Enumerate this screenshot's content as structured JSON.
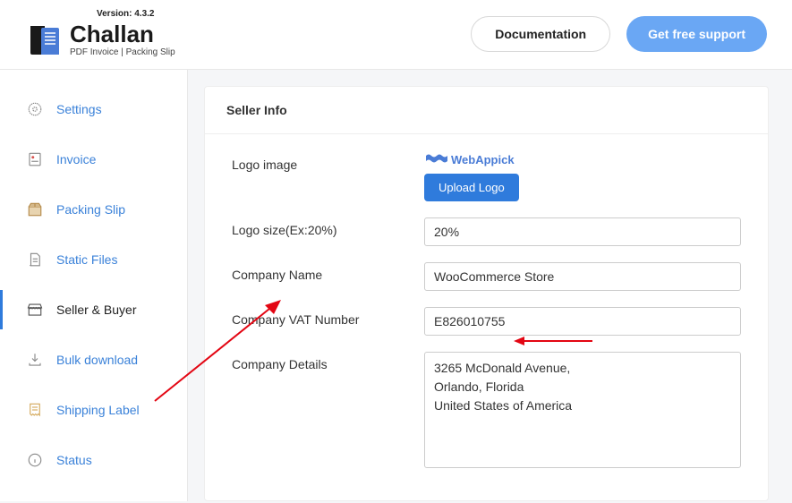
{
  "header": {
    "version_label": "Version: 4.3.2",
    "brand_name": "Challan",
    "brand_sub": "PDF Invoice | Packing Slip",
    "documentation_label": "Documentation",
    "support_label": "Get free support"
  },
  "sidebar": {
    "items": [
      {
        "label": "Settings"
      },
      {
        "label": "Invoice"
      },
      {
        "label": "Packing Slip"
      },
      {
        "label": "Static Files"
      },
      {
        "label": "Seller & Buyer"
      },
      {
        "label": "Bulk download"
      },
      {
        "label": "Shipping Label"
      },
      {
        "label": "Status"
      }
    ]
  },
  "panel": {
    "title": "Seller Info",
    "logo_image_label": "Logo image",
    "logo_preview_text": "WebAppick",
    "upload_logo_label": "Upload Logo",
    "logo_size_label": "Logo size(Ex:20%)",
    "logo_size_value": "20%",
    "company_name_label": "Company Name",
    "company_name_value": "WooCommerce Store",
    "company_vat_label": "Company VAT Number",
    "company_vat_value": "E826010755",
    "company_details_label": "Company Details",
    "company_details_value": "3265 McDonald Avenue,\nOrlando, Florida\nUnited States of America"
  },
  "annotations": {
    "arrow_color": "#e30613"
  }
}
